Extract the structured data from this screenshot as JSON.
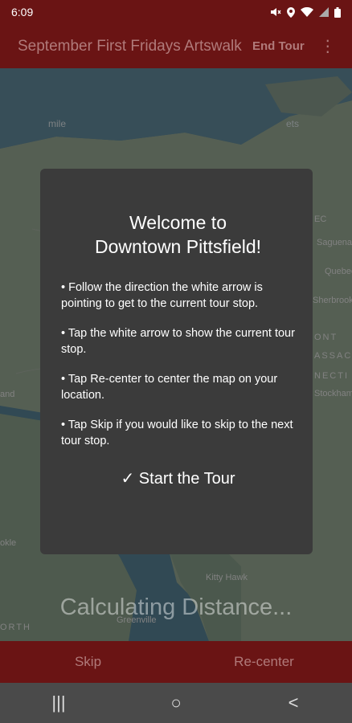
{
  "status": {
    "time": "6:09",
    "icons": [
      "mute-icon",
      "location-icon",
      "wifi-icon",
      "signal-icon",
      "battery-icon"
    ]
  },
  "appbar": {
    "title": "September First Fridays Artswalk",
    "end_tour": "End Tour",
    "menu_icon": "more-vert-icon"
  },
  "map": {
    "labels": [
      "mile",
      "EC",
      "Saguenay",
      "Quebec",
      "Sherbrooke",
      "ONT",
      "ASSAC",
      "NECTI",
      "Stockham",
      "and",
      "okle",
      "Kitty Hawk",
      "Greenville",
      "ORTH",
      "ets"
    ]
  },
  "calculating": "Calculating Distance...",
  "dialog": {
    "title_line1": "Welcome to",
    "title_line2": "Downtown Pittsfield!",
    "instructions": [
      "• Follow the direction the white arrow is pointing to get to the current tour stop.",
      "• Tap the white arrow to show the current tour stop.",
      "• Tap Re-center to center the map on your location.",
      "• Tap Skip if you would like to skip to the next tour stop."
    ],
    "start_label": "✓ Start the Tour"
  },
  "bottom": {
    "skip": "Skip",
    "recenter": "Re-center"
  },
  "navbar": {
    "recents_icon": "|||",
    "home_icon": "○",
    "back_icon": "<"
  }
}
